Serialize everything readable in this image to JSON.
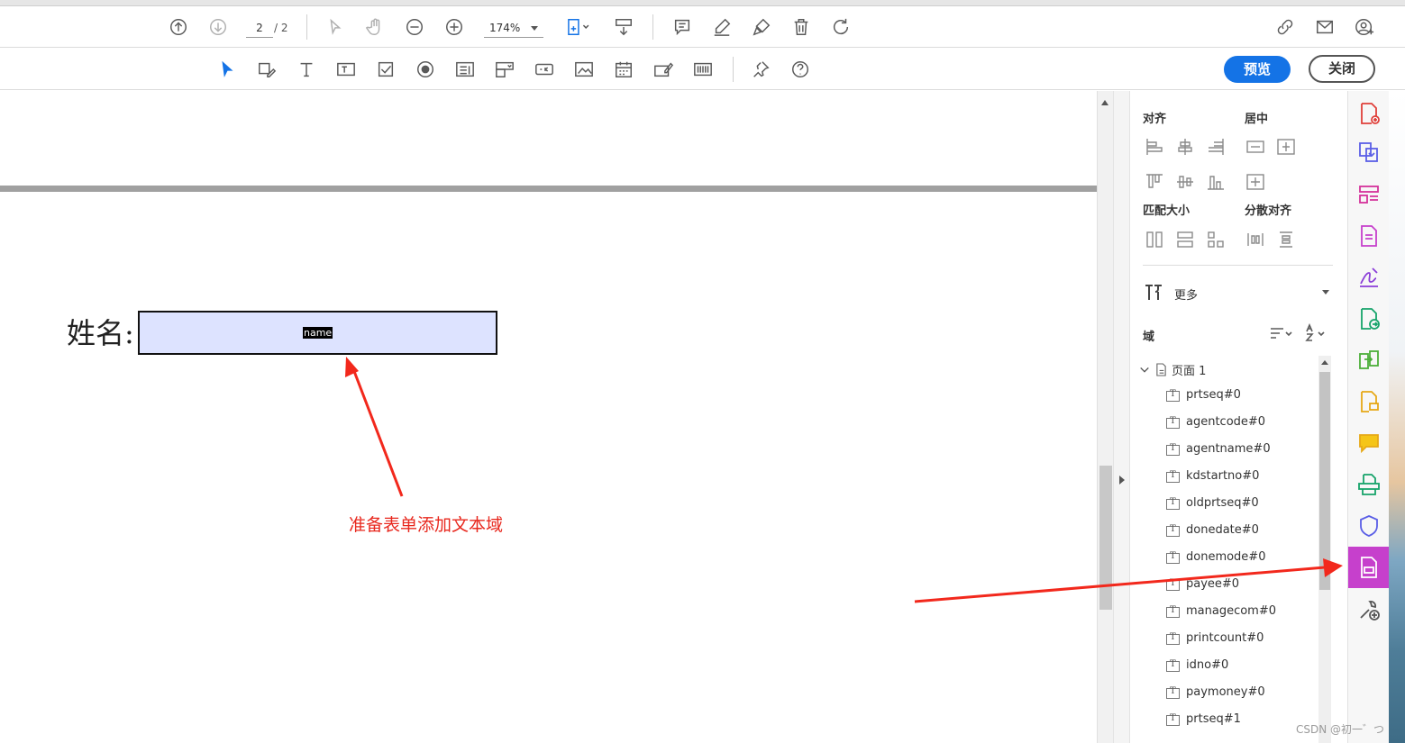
{
  "toolbar1": {
    "page_current": "2",
    "page_total": "/ 2",
    "zoom": "174%"
  },
  "toolbar2": {
    "preview_label": "预览",
    "close_label": "关闭"
  },
  "document": {
    "field_label": "姓名:",
    "field_name": "name",
    "annotation": "准备表单添加文本域"
  },
  "panel": {
    "align_title": "对齐",
    "center_title": "居中",
    "match_size_title": "匹配大小",
    "distribute_title": "分散对齐",
    "more_label": "更多",
    "fields_title": "域",
    "page_node": "页面 1",
    "fields": [
      "prtseq#0",
      "agentcode#0",
      "agentname#0",
      "kdstartno#0",
      "oldprtseq#0",
      "donedate#0",
      "donemode#0",
      "payee#0",
      "managecom#0",
      "printcount#0",
      "idno#0",
      "paymoney#0",
      "prtseq#1"
    ]
  },
  "colors": {
    "accent": "#1473e6",
    "active_tool": "#c640cc",
    "annotation": "#e8281e",
    "field_fill": "#dde3ff"
  },
  "watermark": "CSDN @初一゛つ"
}
